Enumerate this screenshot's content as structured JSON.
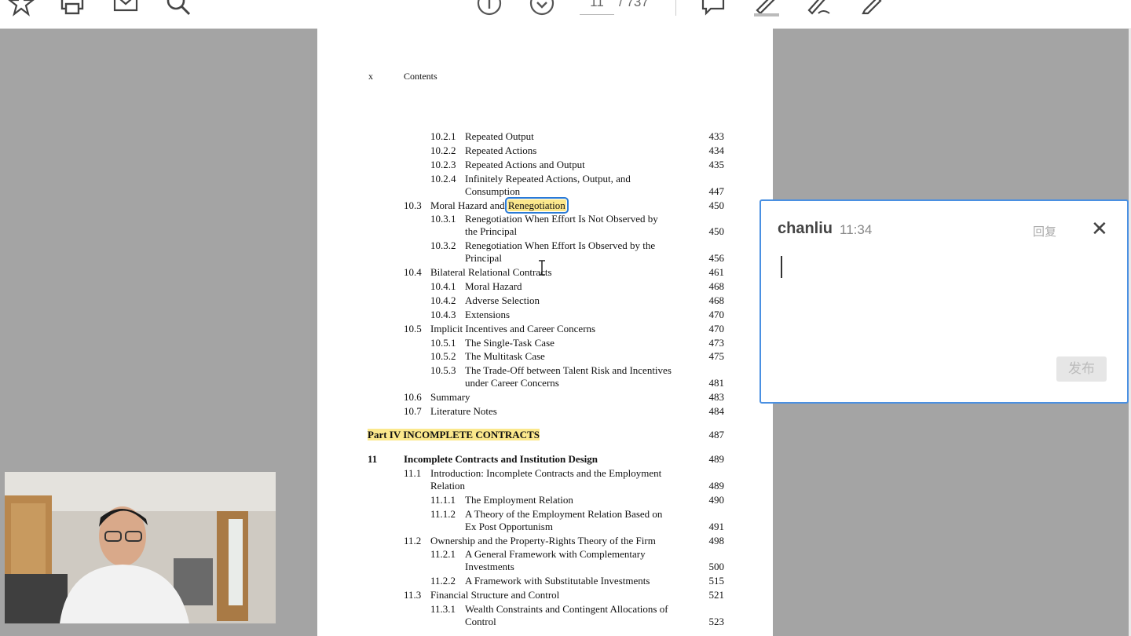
{
  "toolbar": {
    "page_current": "11",
    "page_total": "/ 737"
  },
  "document": {
    "header_x": "x",
    "header_title": "Contents",
    "entries": [
      {
        "num": "10.2.1",
        "title": "Repeated Output",
        "page": "433"
      },
      {
        "num": "10.2.2",
        "title": "Repeated Actions",
        "page": "434"
      },
      {
        "num": "10.2.3",
        "title": "Repeated Actions and Output",
        "page": "435"
      },
      {
        "num": "10.2.4",
        "title": "Infinitely Repeated Actions, Output, and",
        "title2": "Consumption",
        "page": "447"
      },
      {
        "num": "10.3",
        "title": "Moral Hazard and",
        "title_hl": "Renegotiation",
        "page": "450"
      },
      {
        "num": "10.3.1",
        "title": "Renegotiation When Effort Is Not Observed by",
        "title2": "the Principal",
        "page": "450"
      },
      {
        "num": "10.3.2",
        "title": "Renegotiation When Effort Is Observed by the",
        "title2": "Principal",
        "page": "456"
      },
      {
        "num": "10.4",
        "title": "Bilateral Relational Contracts",
        "page": "461"
      },
      {
        "num": "10.4.1",
        "title": "Moral Hazard",
        "page": "468"
      },
      {
        "num": "10.4.2",
        "title": "Adverse Selection",
        "page": "468"
      },
      {
        "num": "10.4.3",
        "title": "Extensions",
        "page": "470"
      },
      {
        "num": "10.5",
        "title": "Implicit Incentives and Career Concerns",
        "page": "470"
      },
      {
        "num": "10.5.1",
        "title": "The Single-Task Case",
        "page": "473"
      },
      {
        "num": "10.5.2",
        "title": "The Multitask Case",
        "page": "475"
      },
      {
        "num": "10.5.3",
        "title": "The Trade-Off between Talent Risk and Incentives",
        "title2": "under Career Concerns",
        "page": "481"
      },
      {
        "num": "10.6",
        "title": "Summary",
        "page": "483"
      },
      {
        "num": "10.7",
        "title": "Literature Notes",
        "page": "484"
      },
      {
        "title": "Part IV INCOMPLETE CONTRACTS",
        "page": "487"
      },
      {
        "num": "11",
        "title": "Incomplete Contracts and Institution Design",
        "page": "489"
      },
      {
        "num": "11.1",
        "title": "Introduction: Incomplete Contracts and the Employment",
        "title2": "Relation",
        "page": "489"
      },
      {
        "num": "11.1.1",
        "title": "The Employment Relation",
        "page": "490"
      },
      {
        "num": "11.1.2",
        "title": "A Theory of the Employment Relation Based on",
        "title2": "Ex Post Opportunism",
        "page": "491"
      },
      {
        "num": "11.2",
        "title": "Ownership and the Property-Rights Theory of the Firm",
        "page": "498"
      },
      {
        "num": "11.2.1",
        "title": "A General Framework with Complementary",
        "title2": "Investments",
        "page": "500"
      },
      {
        "num": "11.2.2",
        "title": "A Framework with Substitutable Investments",
        "page": "515"
      },
      {
        "num": "11.3",
        "title": "Financial Structure and Control",
        "page": "521"
      },
      {
        "num": "11.3.1",
        "title": "Wealth Constraints and Contingent Allocations of",
        "title2": "Control",
        "page": "523"
      }
    ]
  },
  "comment": {
    "user": "chanliu",
    "time": "11:34",
    "reply_label": "回复",
    "close_label": "✕",
    "post_label": "发布"
  },
  "colors": {
    "highlight": "#fbe88c",
    "selection_border": "#2a7ad6",
    "panel_border": "#4a90e2",
    "viewer_background": "#a4a4a4"
  }
}
